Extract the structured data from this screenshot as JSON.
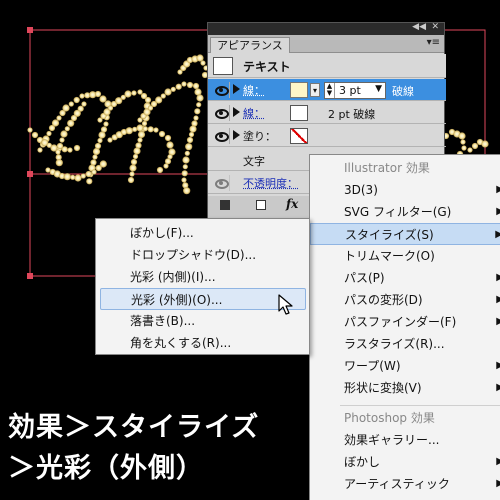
{
  "artwork": {
    "name": "glowing dotted script lettering"
  },
  "appearance_panel": {
    "tab": "アピアランス",
    "header_title": "テキスト",
    "rows": [
      {
        "label": "線：",
        "weight": "3 pt",
        "style": "破線"
      },
      {
        "label": "線：",
        "value": "2 pt 破線"
      },
      {
        "label": "塗り："
      }
    ],
    "text_label": "文字",
    "opacity_label": "不透明度："
  },
  "effect_menu": {
    "header1": "Illustrator 効果",
    "items1": [
      "3D(3)",
      "SVG フィルター(G)",
      "スタイライズ(S)",
      "トリムマーク(O)",
      "パス(P)",
      "パスの変形(D)",
      "パスファインダー(F)",
      "ラスタライズ(R)...",
      "ワープ(W)",
      "形状に変換(V)"
    ],
    "header2": "Photoshop 効果",
    "items2": [
      "効果ギャラリー...",
      "ぼかし",
      "アーティスティック"
    ]
  },
  "stylize_menu": {
    "items": [
      "ぼかし(F)...",
      "ドロップシャドウ(D)...",
      "光彩 (内側)(I)...",
      "光彩 (外側)(O)...",
      "落書き(B)...",
      "角を丸くする(R)..."
    ]
  },
  "caption": {
    "line1": "効果＞スタイライズ",
    "line2": "＞光彩（外側）"
  },
  "colors": {
    "highlight": "#3c8fe0",
    "stroke_swatch": "#f3d27a",
    "glow": "#fff1b8"
  }
}
